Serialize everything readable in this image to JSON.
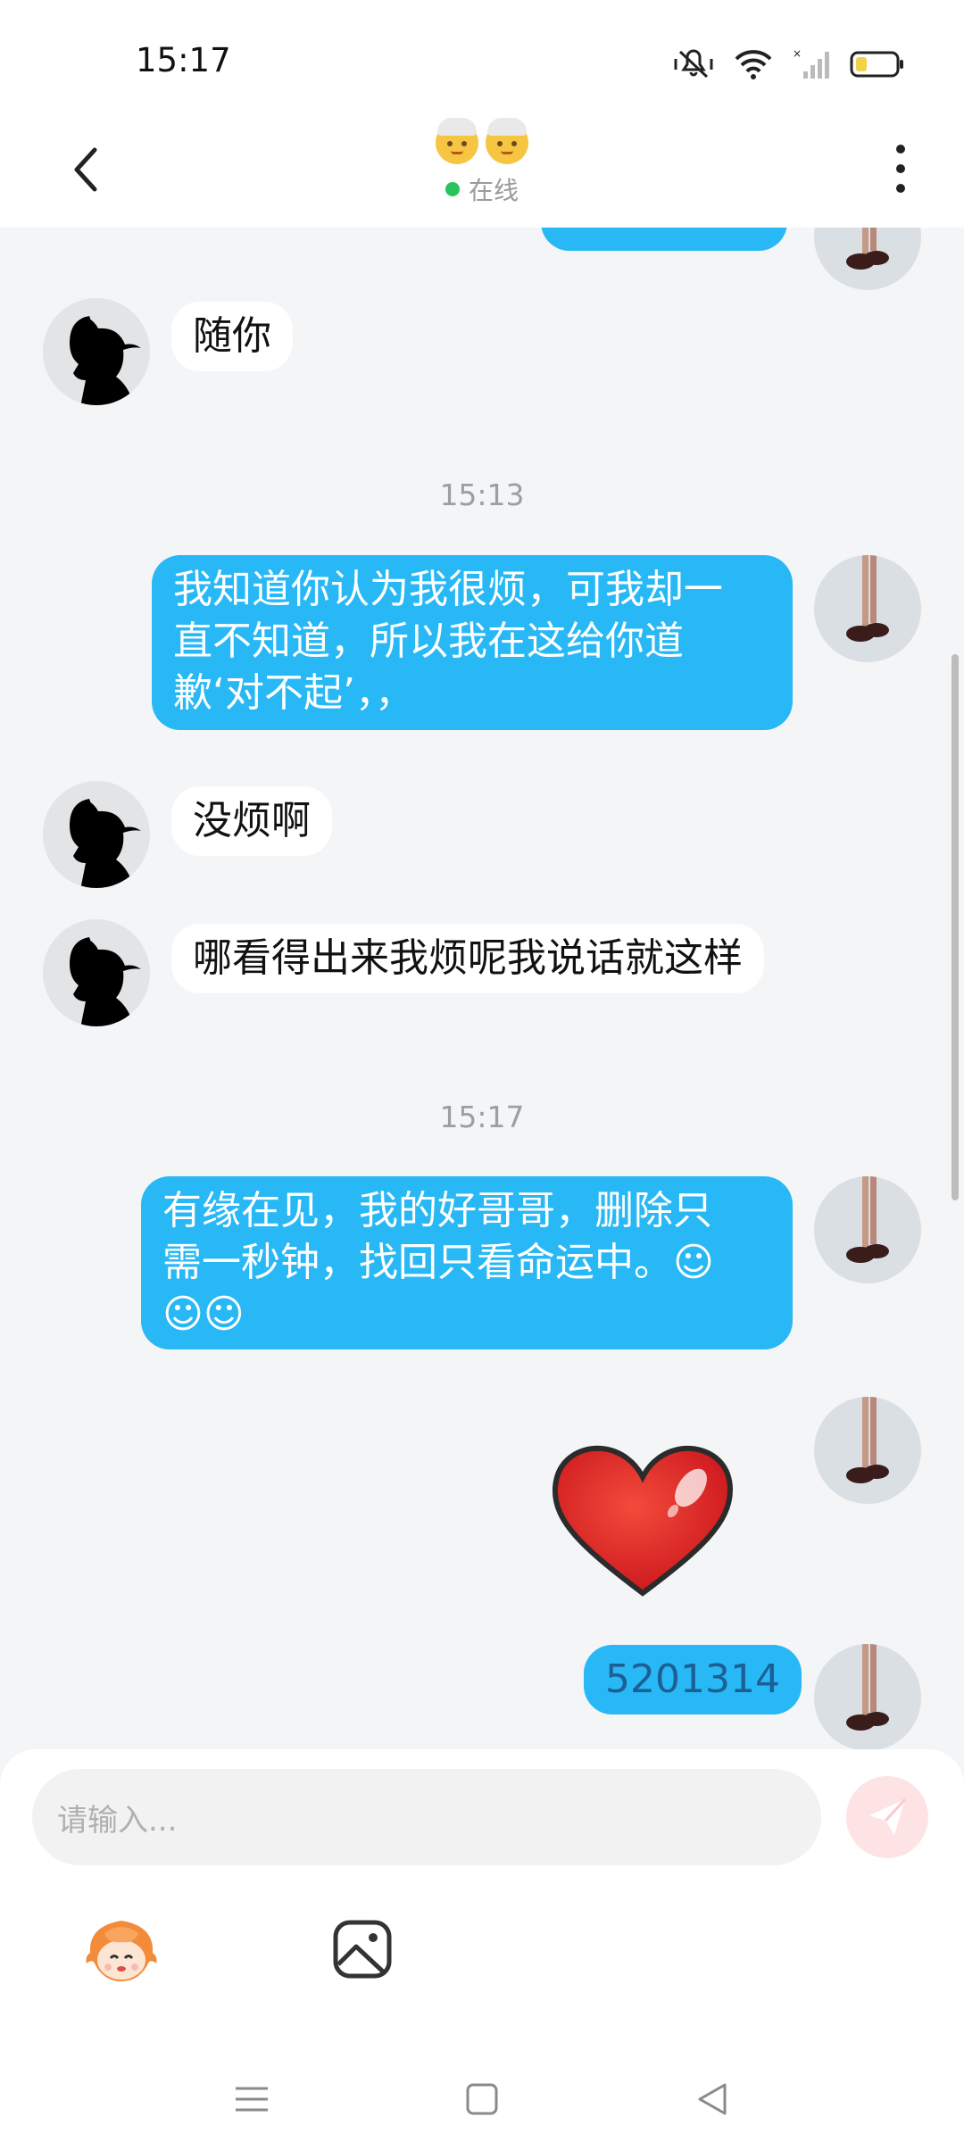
{
  "status_bar": {
    "time": "15:17",
    "icons": [
      "mute-vibrate-icon",
      "wifi-icon",
      "signal-off-icon",
      "battery-low-icon"
    ]
  },
  "header": {
    "title_emoji": [
      "older-person-emoji",
      "older-person-emoji"
    ],
    "status_text": "在线",
    "status_color": "#2ac45e"
  },
  "messages": [
    {
      "side": "out",
      "text": "",
      "partial": true
    },
    {
      "side": "in",
      "text": "随你"
    },
    {
      "type": "timestamp",
      "text": "15:13"
    },
    {
      "side": "out",
      "lines": [
        "我知道你认为我很烦，可我却一",
        "直不知道，所以我在这给你道",
        "歉‘对不起’，，"
      ]
    },
    {
      "side": "in",
      "text": "没烦啊"
    },
    {
      "side": "in",
      "text": "哪看得出来我烦呢我说话就这样"
    },
    {
      "type": "timestamp",
      "text": "15:17"
    },
    {
      "side": "out",
      "lines": [
        "有缘在见，我的好哥哥，删除只",
        "需一秒钟，找回只看命运中。☺",
        "☺☺"
      ]
    },
    {
      "side": "out",
      "type": "sticker",
      "sticker": "red-heart-sticker"
    },
    {
      "side": "out",
      "text": "5201314"
    }
  ],
  "colors": {
    "outgoing_bubble": "#28b8f5",
    "incoming_bubble": "#ffffff",
    "background": "#f4f5f7"
  },
  "composer": {
    "placeholder": "请输入...",
    "send_icon": "send-paper-plane-icon",
    "tools": [
      "emoji-sticker-icon",
      "image-gallery-icon"
    ]
  },
  "nav_bar": [
    "menu-icon",
    "home-square-icon",
    "back-triangle-icon"
  ]
}
